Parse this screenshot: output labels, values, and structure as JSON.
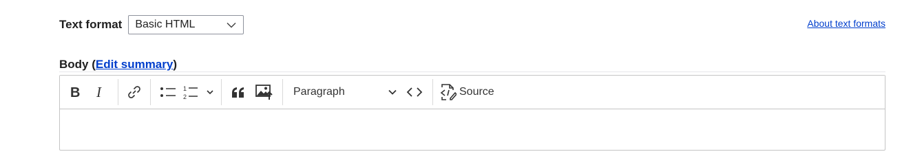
{
  "text_format": {
    "label": "Text format",
    "selected": "Basic HTML",
    "help_link": "About text formats"
  },
  "body_field": {
    "label": "Body",
    "open_paren": "(",
    "edit_summary_link": "Edit summary",
    "close_paren": ")"
  },
  "toolbar": {
    "buttons": [
      {
        "name": "bold",
        "icon": "bold-icon"
      },
      {
        "name": "italic",
        "icon": "italic-icon"
      },
      {
        "name": "link",
        "icon": "link-icon"
      },
      {
        "name": "bulleted-list",
        "icon": "bulleted-list-icon"
      },
      {
        "name": "numbered-list",
        "icon": "numbered-list-icon"
      },
      {
        "name": "block-quote",
        "icon": "quote-icon"
      },
      {
        "name": "insert-image",
        "icon": "image-upload-icon"
      },
      {
        "name": "code",
        "icon": "code-icon"
      }
    ],
    "heading_value": "Paragraph",
    "source_label": "Source"
  }
}
